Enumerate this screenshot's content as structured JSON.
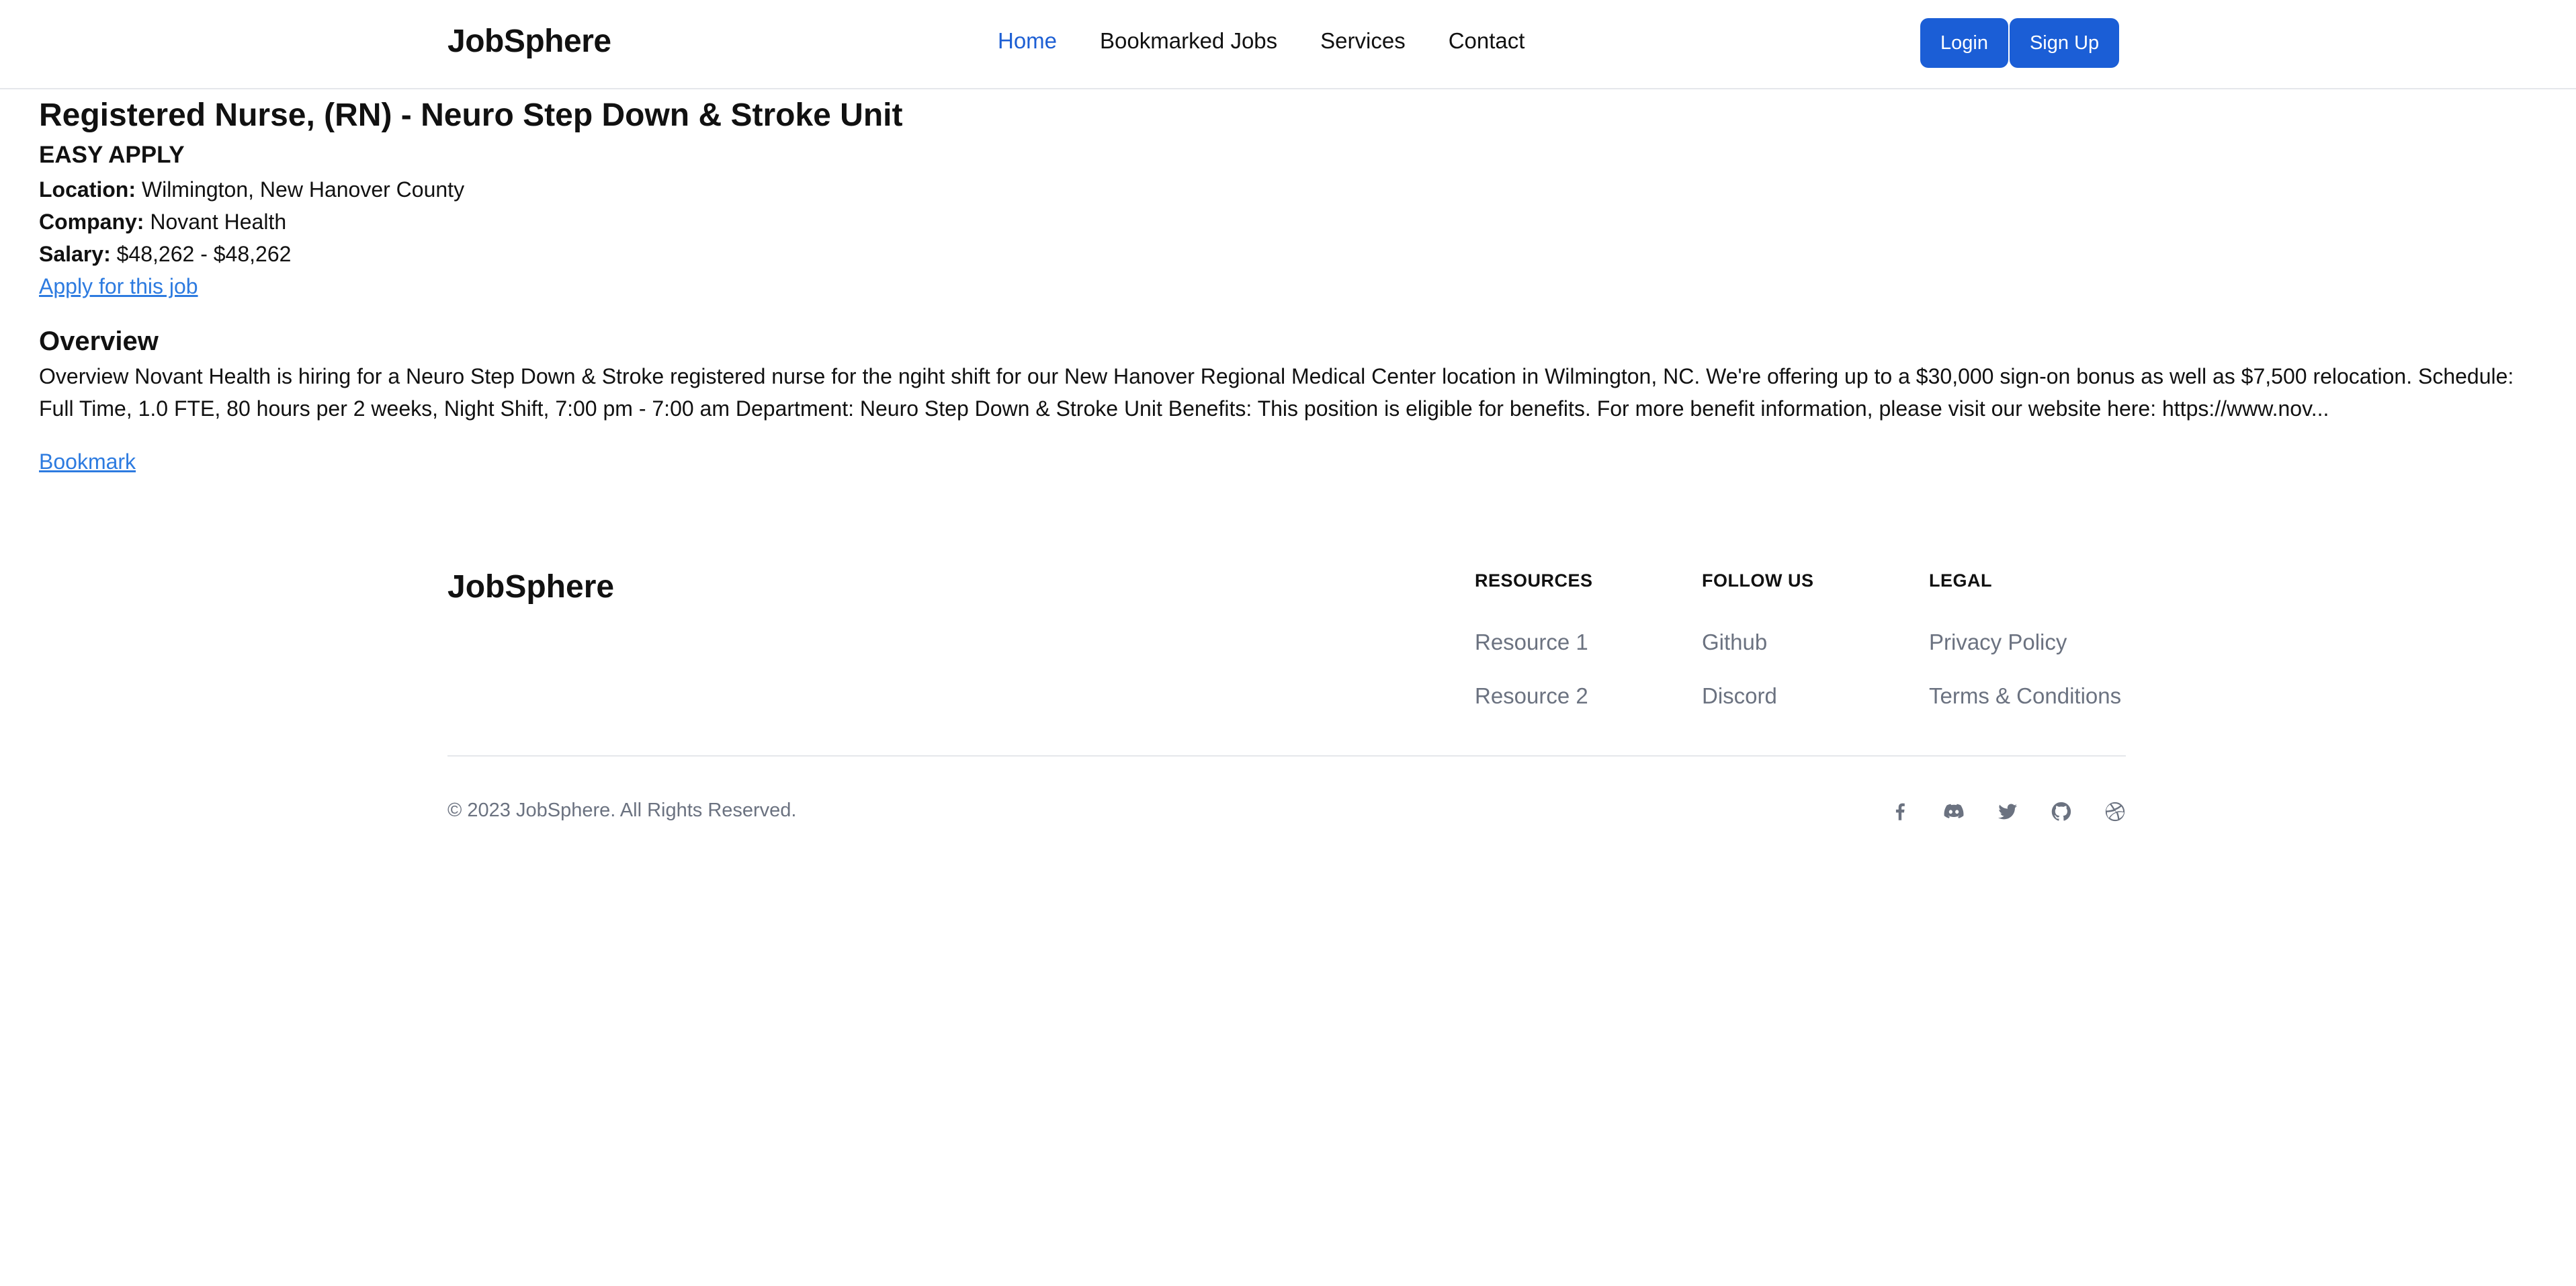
{
  "header": {
    "brand": "JobSphere",
    "nav": [
      {
        "label": "Home",
        "active": true
      },
      {
        "label": "Bookmarked Jobs",
        "active": false
      },
      {
        "label": "Services",
        "active": false
      },
      {
        "label": "Contact",
        "active": false
      }
    ],
    "login_label": "Login",
    "signup_label": "Sign Up"
  },
  "job": {
    "title": "Registered Nurse, (RN) - Neuro Step Down & Stroke Unit",
    "easy_apply": "EASY APPLY",
    "location_label": "Location:",
    "location": "Wilmington, New Hanover County",
    "company_label": "Company:",
    "company": "Novant Health",
    "salary_label": "Salary:",
    "salary": "$48,262 - $48,262",
    "apply_link": "Apply for this job",
    "overview_heading": "Overview",
    "overview_text": "Overview Novant Health is hiring for a Neuro Step Down & Stroke registered nurse for the ngiht shift for our New Hanover Regional Medical Center location in Wilmington, NC. We're offering up to a $30,000 sign-on bonus as well as $7,500 relocation. Schedule: Full Time, 1.0 FTE, 80 hours per 2 weeks, Night Shift, 7:00 pm - 7:00 am Department: Neuro Step Down & Stroke Unit Benefits: This position is eligible for benefits. For more benefit information, please visit our website here: https://www.nov...",
    "bookmark_link": "Bookmark"
  },
  "footer": {
    "brand": "JobSphere",
    "columns": [
      {
        "heading": "RESOURCES",
        "links": [
          "Resource 1",
          "Resource 2"
        ]
      },
      {
        "heading": "FOLLOW US",
        "links": [
          "Github",
          "Discord"
        ]
      },
      {
        "heading": "LEGAL",
        "links": [
          "Privacy Policy",
          "Terms & Conditions"
        ]
      }
    ],
    "copyright": "© 2023 JobSphere. All Rights Reserved.",
    "social_icons": [
      "facebook-icon",
      "discord-icon",
      "twitter-icon",
      "github-icon",
      "dribbble-icon"
    ]
  },
  "colors": {
    "accent": "#1b5ed6",
    "link": "#2d7be0",
    "muted": "#6b7280",
    "active_nav": "#1d5fd4"
  }
}
